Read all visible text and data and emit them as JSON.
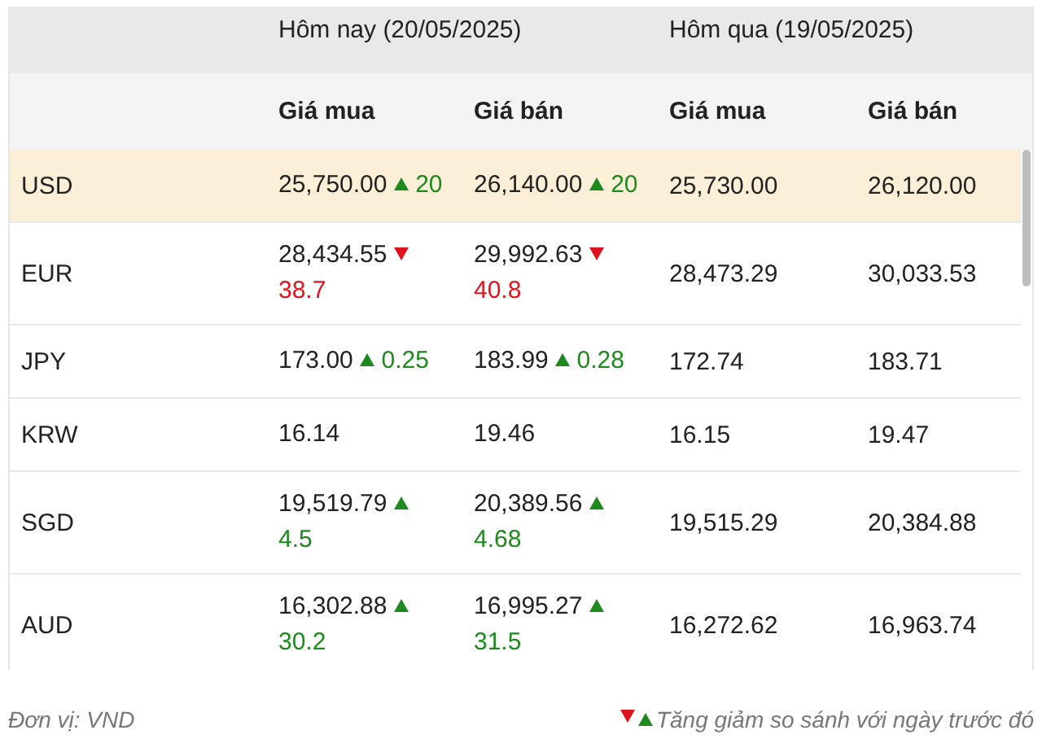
{
  "header": {
    "groups": [
      "Hôm nay (20/05/2025)",
      "Hôm qua (19/05/2025)"
    ],
    "columns": [
      "Giá mua",
      "Giá bán",
      "Giá mua",
      "Giá bán"
    ]
  },
  "rows": [
    {
      "currency": "USD",
      "selected": true,
      "today_buy": {
        "value": "25,750.00",
        "kind": "up",
        "change": "20"
      },
      "today_sell": {
        "value": "26,140.00",
        "kind": "up",
        "change": "20"
      },
      "prev_buy": "25,730.00",
      "prev_sell": "26,120.00"
    },
    {
      "currency": "EUR",
      "selected": false,
      "today_buy": {
        "value": "28,434.55",
        "kind": "down",
        "change": "38.7"
      },
      "today_sell": {
        "value": "29,992.63",
        "kind": "down",
        "change": "40.8"
      },
      "prev_buy": "28,473.29",
      "prev_sell": "30,033.53"
    },
    {
      "currency": "JPY",
      "selected": false,
      "today_buy": {
        "value": "173.00",
        "kind": "up",
        "change": "0.25"
      },
      "today_sell": {
        "value": "183.99",
        "kind": "up",
        "change": "0.28"
      },
      "prev_buy": "172.74",
      "prev_sell": "183.71"
    },
    {
      "currency": "KRW",
      "selected": false,
      "today_buy": {
        "value": "16.14",
        "kind": "none"
      },
      "today_sell": {
        "value": "19.46",
        "kind": "none"
      },
      "prev_buy": "16.15",
      "prev_sell": "19.47"
    },
    {
      "currency": "SGD",
      "selected": false,
      "today_buy": {
        "value": "19,519.79",
        "kind": "up",
        "change": "4.5"
      },
      "today_sell": {
        "value": "20,389.56",
        "kind": "up",
        "change": "4.68"
      },
      "prev_buy": "19,515.29",
      "prev_sell": "20,384.88"
    },
    {
      "currency": "AUD",
      "selected": false,
      "today_buy": {
        "value": "16,302.88",
        "kind": "up",
        "change": "30.2"
      },
      "today_sell": {
        "value": "16,995.27",
        "kind": "up",
        "change": "31.5"
      },
      "prev_buy": "16,272.62",
      "prev_sell": "16,963.74"
    }
  ],
  "footer": {
    "unit": "Đơn vị: VND",
    "legend": "Tăng giảm so sánh với ngày trước đó"
  }
}
